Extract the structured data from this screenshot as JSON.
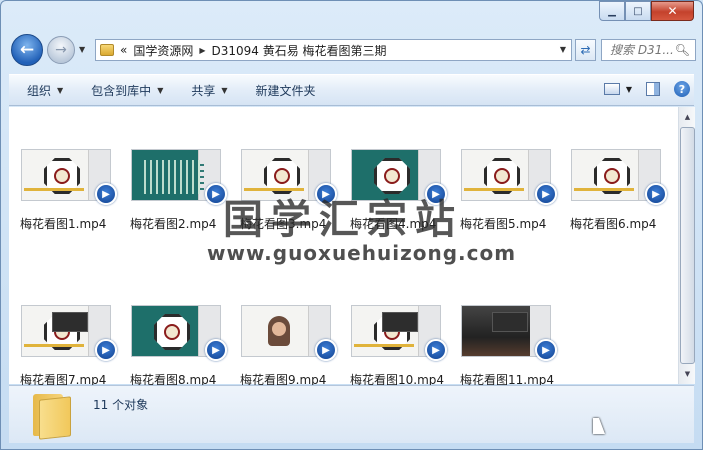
{
  "window": {
    "caption": {
      "minimize": "▭",
      "maximize": "□",
      "close": "✕"
    }
  },
  "nav": {
    "back_glyph": "←",
    "forward_glyph": "→",
    "address": {
      "overflow": "«",
      "segments": [
        "国学资源网",
        "D31094 黄石易  梅花看图第三期"
      ]
    },
    "search": {
      "placeholder": "搜索 D31..."
    }
  },
  "commands": {
    "organize": "组织",
    "include_library": "包含到库中",
    "share": "共享",
    "new_folder": "新建文件夹"
  },
  "icons": {
    "back": "arrow-left-icon",
    "forward": "arrow-right-icon",
    "refresh": "refresh-icon",
    "search": "search-icon",
    "view": "view-options-icon",
    "preview_pane": "preview-pane-icon",
    "help": "help-icon",
    "play_badge": "media-player-icon",
    "folder": "folder-icon"
  },
  "files": [
    {
      "name": "梅花看图1.mp4",
      "thumb": "octagon"
    },
    {
      "name": "梅花看图2.mp4",
      "thumb": "teal-grid"
    },
    {
      "name": "梅花看图3.mp4",
      "thumb": "octagon"
    },
    {
      "name": "梅花看图4.mp4",
      "thumb": "teal-octagon"
    },
    {
      "name": "梅花看图5.mp4",
      "thumb": "octagon"
    },
    {
      "name": "梅花看图6.mp4",
      "thumb": "octagon"
    },
    {
      "name": "梅花看图7.mp4",
      "thumb": "octagon-popup"
    },
    {
      "name": "梅花看图8.mp4",
      "thumb": "teal-octagon"
    },
    {
      "name": "梅花看图9.mp4",
      "thumb": "person"
    },
    {
      "name": "梅花看图10.mp4",
      "thumb": "octagon-popup"
    },
    {
      "name": "梅花看图11.mp4",
      "thumb": "dark-scene"
    }
  ],
  "watermark": {
    "text_cn": "国学汇宗站",
    "url": "www.guoxuehuizong.com"
  },
  "status": {
    "item_count": "11 个对象"
  },
  "colors": {
    "accent": "#1f5fb5",
    "close": "#c4422c",
    "folder": "#f1c85b"
  }
}
